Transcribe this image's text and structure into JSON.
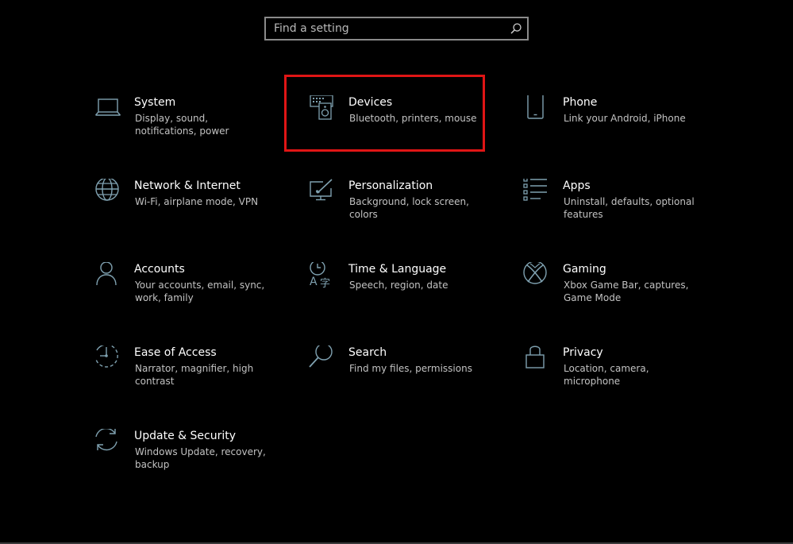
{
  "search": {
    "placeholder": "Find a setting",
    "icon": "search-icon"
  },
  "tiles": [
    {
      "title": "System",
      "desc": "Display, sound, notifications, power",
      "icon": "laptop-icon"
    },
    {
      "title": "Devices",
      "desc": "Bluetooth, printers, mouse",
      "icon": "keyboard-speaker-icon"
    },
    {
      "title": "Phone",
      "desc": "Link your Android, iPhone",
      "icon": "phone-icon"
    },
    {
      "title": "Network & Internet",
      "desc": "Wi-Fi, airplane mode, VPN",
      "icon": "globe-icon"
    },
    {
      "title": "Personalization",
      "desc": "Background, lock screen, colors",
      "icon": "paintbrush-monitor-icon"
    },
    {
      "title": "Apps",
      "desc": "Uninstall, defaults, optional features",
      "icon": "apps-list-icon"
    },
    {
      "title": "Accounts",
      "desc": "Your accounts, email, sync, work, family",
      "icon": "person-icon"
    },
    {
      "title": "Time & Language",
      "desc": "Speech, region, date",
      "icon": "clock-language-icon"
    },
    {
      "title": "Gaming",
      "desc": "Xbox Game Bar, captures, Game Mode",
      "icon": "xbox-icon"
    },
    {
      "title": "Ease of Access",
      "desc": "Narrator, magnifier, high contrast",
      "icon": "ease-of-access-icon"
    },
    {
      "title": "Search",
      "desc": "Find my files, permissions",
      "icon": "magnifier-icon"
    },
    {
      "title": "Privacy",
      "desc": "Location, camera, microphone",
      "icon": "lock-icon"
    },
    {
      "title": "Update & Security",
      "desc": "Windows Update, recovery, backup",
      "icon": "sync-icon"
    }
  ],
  "highlight": {
    "target": "Devices",
    "color": "#e01515"
  },
  "colors": {
    "background": "#000000",
    "icon": "#7fa1b0",
    "title": "#ffffff",
    "description": "#c2c2c2"
  }
}
